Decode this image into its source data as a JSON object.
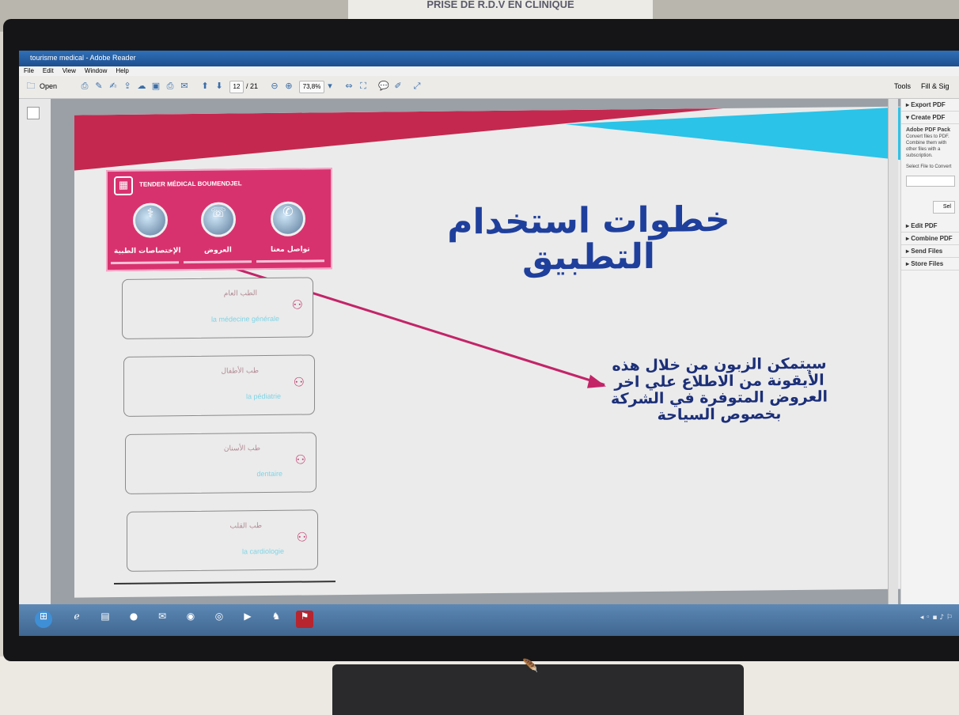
{
  "photo": {
    "poster_text": "PRISE DE R.D.V EN CLINIQUE"
  },
  "window": {
    "title": "tourisme medical - Adobe Reader",
    "menu": [
      "File",
      "Edit",
      "View",
      "Window",
      "Help"
    ]
  },
  "toolbar": {
    "open_label": "Open",
    "page_current": "12",
    "page_total": "/ 21",
    "zoom": "73,8%",
    "tools_label": "Tools",
    "fill_sign_label": "Fill & Sig"
  },
  "right_pane": {
    "export_pdf": "▸ Export PDF",
    "create_pdf": "▾ Create PDF",
    "pack_title": "Adobe PDF Pack",
    "pack_desc": "Convert files to PDF. Combine them with other files with a subscription.",
    "select_label": "Select File to Convert",
    "select_button": "Sel",
    "edit_pdf": "▸ Edit PDF",
    "combine_pdf": "▸ Combine PDF",
    "send_files": "▸ Send Files",
    "store_files": "▸ Store Files"
  },
  "slide": {
    "app_title": "TENDER MÉDICAL BOUMENDJEL",
    "icons": [
      {
        "label": "الإختصاصات الطبية",
        "icon": "medical-icon"
      },
      {
        "label": "العروض",
        "icon": "phone-icon"
      },
      {
        "label": "تواصل معنا",
        "icon": "contact-icon"
      }
    ],
    "cards": [
      {
        "ar": "الطب العام",
        "fr": "la médecine générale"
      },
      {
        "ar": "طب الأطفال",
        "fr": "la pédiatrie"
      },
      {
        "ar": "طب الأسنان",
        "fr": "dentaire"
      },
      {
        "ar": "طب القلب",
        "fr": "la cardiologie"
      }
    ],
    "headline_1": "خطوات استخدام",
    "headline_2": "التطبيق",
    "description": "سيتمكن الزبون من خلال هذه الأيقونة من الاطلاع علي اخر العروض المتوفرة في الشركة بخصوص السياحة",
    "colors": {
      "pink": "#d8326e",
      "blue": "#1f3f9c",
      "cyan": "#2bc3e8",
      "red": "#c5284f"
    }
  },
  "monitor": {
    "brand_logo": "🪶"
  }
}
